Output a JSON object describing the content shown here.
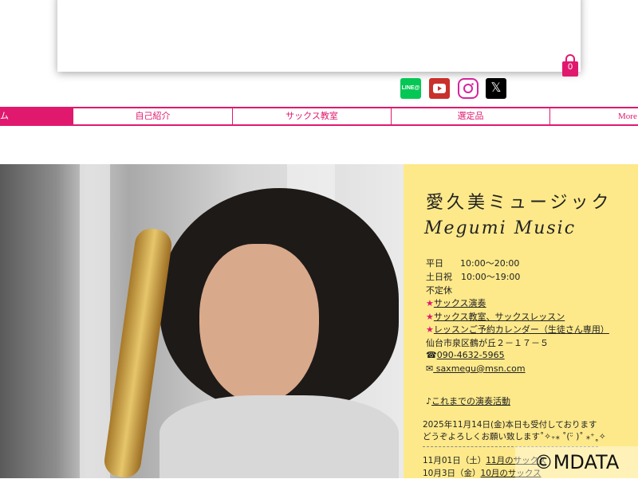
{
  "header": {
    "cart_count": "0"
  },
  "social": {
    "line_label": "LINE@",
    "x_label": "𝕏"
  },
  "nav": {
    "items": [
      {
        "label": "ム"
      },
      {
        "label": "自己紹介"
      },
      {
        "label": "サックス教室"
      },
      {
        "label": "選定品"
      },
      {
        "label": "More"
      }
    ]
  },
  "panel": {
    "title": "愛久美ミュージック",
    "subtitle": "Megumi Music",
    "weekday_label": "平日",
    "weekday_hours": "10:00〜20:00",
    "weekend_label": "土日祝",
    "weekend_hours": "10:00〜19:00",
    "closed": "不定休",
    "link1": "サックス演奏",
    "link2": "サックス教室、サックスレッスン",
    "link3": "レッスンご予約カレンダー（生徒さん専用）",
    "address": "仙台市泉区鶴が丘２－１７－５",
    "phone_prefix": "☎",
    "phone": "090-4632-5965",
    "mail_prefix": "✉",
    "email": " saxmegu@msn.com",
    "history_prefix": "♪",
    "history_link": "これまでの演奏活動",
    "notice1": "2025年11月14日(金)本日も受付しております",
    "notice2": "どうぞよろしくお願い致します˚✧₊⁎ ˚(ᵕ̈ )˚ ⁎⁺˳✧",
    "sched1_prefix": "11月01日（土）",
    "sched1_link": "11月のサックス",
    "sched2_prefix": "10月3日（金）",
    "sched2_link": "10月のサックス"
  },
  "watermark": "©MDATA",
  "colors": {
    "accent": "#e0196e",
    "panel_bg": "#fde98a"
  }
}
